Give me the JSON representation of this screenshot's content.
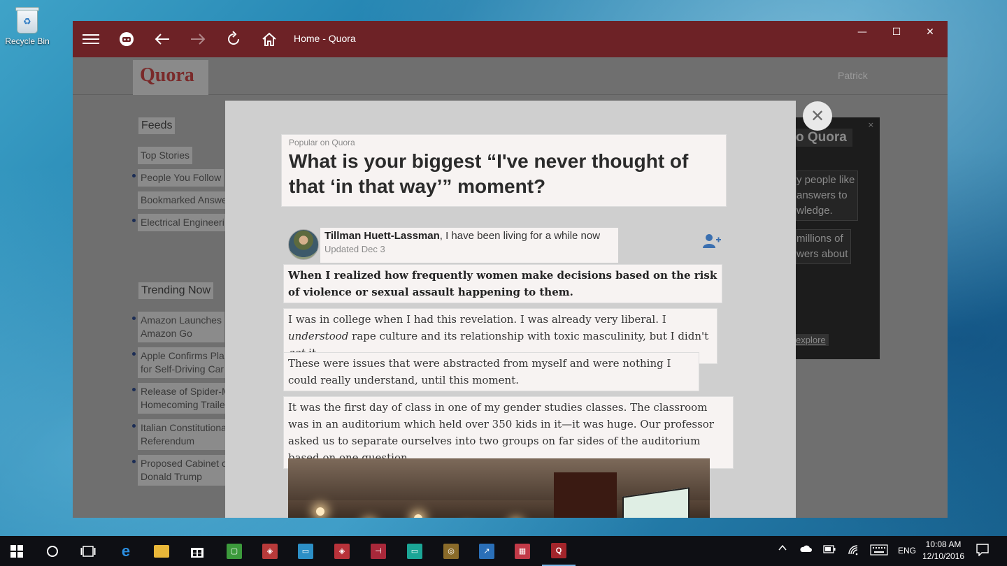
{
  "desktop": {
    "recycle_bin_label": "Recycle Bin"
  },
  "window": {
    "title": "Home - Quora",
    "controls": {
      "minimize": "—",
      "maximize": "☐",
      "close": "✕"
    }
  },
  "quora_page": {
    "logo": "Quora",
    "user_name": "Patrick",
    "feeds_heading": "Feeds",
    "feeds": [
      "Top Stories",
      "People You Follow",
      "Bookmarked Answe",
      "Electrical Engineeri"
    ],
    "trending_heading": "Trending Now",
    "trending": [
      [
        "Amazon Launches",
        "Amazon Go"
      ],
      [
        "Apple Confirms Pla",
        "for Self-Driving Car"
      ],
      [
        "Release of Spider-M",
        "Homecoming Traile"
      ],
      [
        "Italian Constitutiona",
        "Referendum"
      ],
      [
        "Proposed Cabinet o",
        "Donald Trump"
      ]
    ],
    "promo": {
      "title": "o Quora",
      "p1": [
        "y people like",
        "answers to",
        "wledge."
      ],
      "p2": [
        "millions of",
        "wers about"
      ],
      "explore": "explore",
      "close": "×"
    }
  },
  "modal": {
    "popular_label": "Popular on Quora",
    "question": "What is your biggest “I've never thought of that ‘in that way’” moment?",
    "author_name": "Tillman Huett-Lassman",
    "author_bio": ", I have been living for a while now",
    "updated": "Updated Dec 3",
    "close_icon": "✕",
    "follow_icon": "person-add-icon",
    "paragraphs": {
      "p1": "When I realized how frequently women make decisions based on the risk of violence or sexual assault happening to them.",
      "p2a": "I was in college when I had this revelation. I was already very liberal. I ",
      "p2b": "understood",
      "p2c": " rape culture and its relationship with toxic masculinity, but I didn't ",
      "p2d": "get",
      "p2e": " it.",
      "p3": "These were issues that were abstracted from myself and were nothing I could really understand, until this moment.",
      "p4": "It was the first day of class in one of my gender studies classes. The classroom was in an auditorium which held over 350 kids in it—it was huge. Our professor asked us to separate ourselves into two groups on far sides of the auditorium based on one question."
    }
  },
  "taskbar": {
    "lang": "ENG",
    "time": "10:08 AM",
    "date": "12/10/2016"
  }
}
